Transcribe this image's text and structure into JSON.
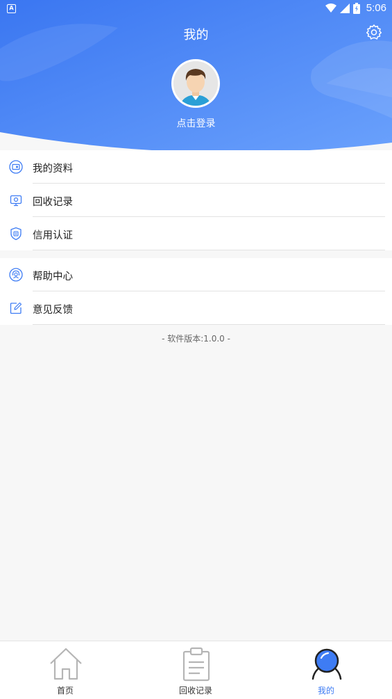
{
  "status_bar": {
    "time": "5:06",
    "app_icon": "A"
  },
  "header": {
    "title": "我的",
    "login_text": "点击登录"
  },
  "colors": {
    "accent": "#3e7cf4",
    "header_top": "#3b78f2",
    "header_bottom": "#5f98fb"
  },
  "menu_group_1": [
    {
      "label": "我的资料",
      "icon": "profile-card-icon"
    },
    {
      "label": "回收记录",
      "icon": "recycle-record-icon"
    },
    {
      "label": "信用认证",
      "icon": "shield-icon"
    }
  ],
  "menu_group_2": [
    {
      "label": "帮助中心",
      "icon": "help-headset-icon"
    },
    {
      "label": "意见反馈",
      "icon": "edit-feedback-icon"
    }
  ],
  "version_text": "- 软件版本:1.0.0 -",
  "tabbar": [
    {
      "label": "首页",
      "icon": "home-icon",
      "active": false
    },
    {
      "label": "回收记录",
      "icon": "clipboard-icon",
      "active": false
    },
    {
      "label": "我的",
      "icon": "user-icon",
      "active": true
    }
  ]
}
